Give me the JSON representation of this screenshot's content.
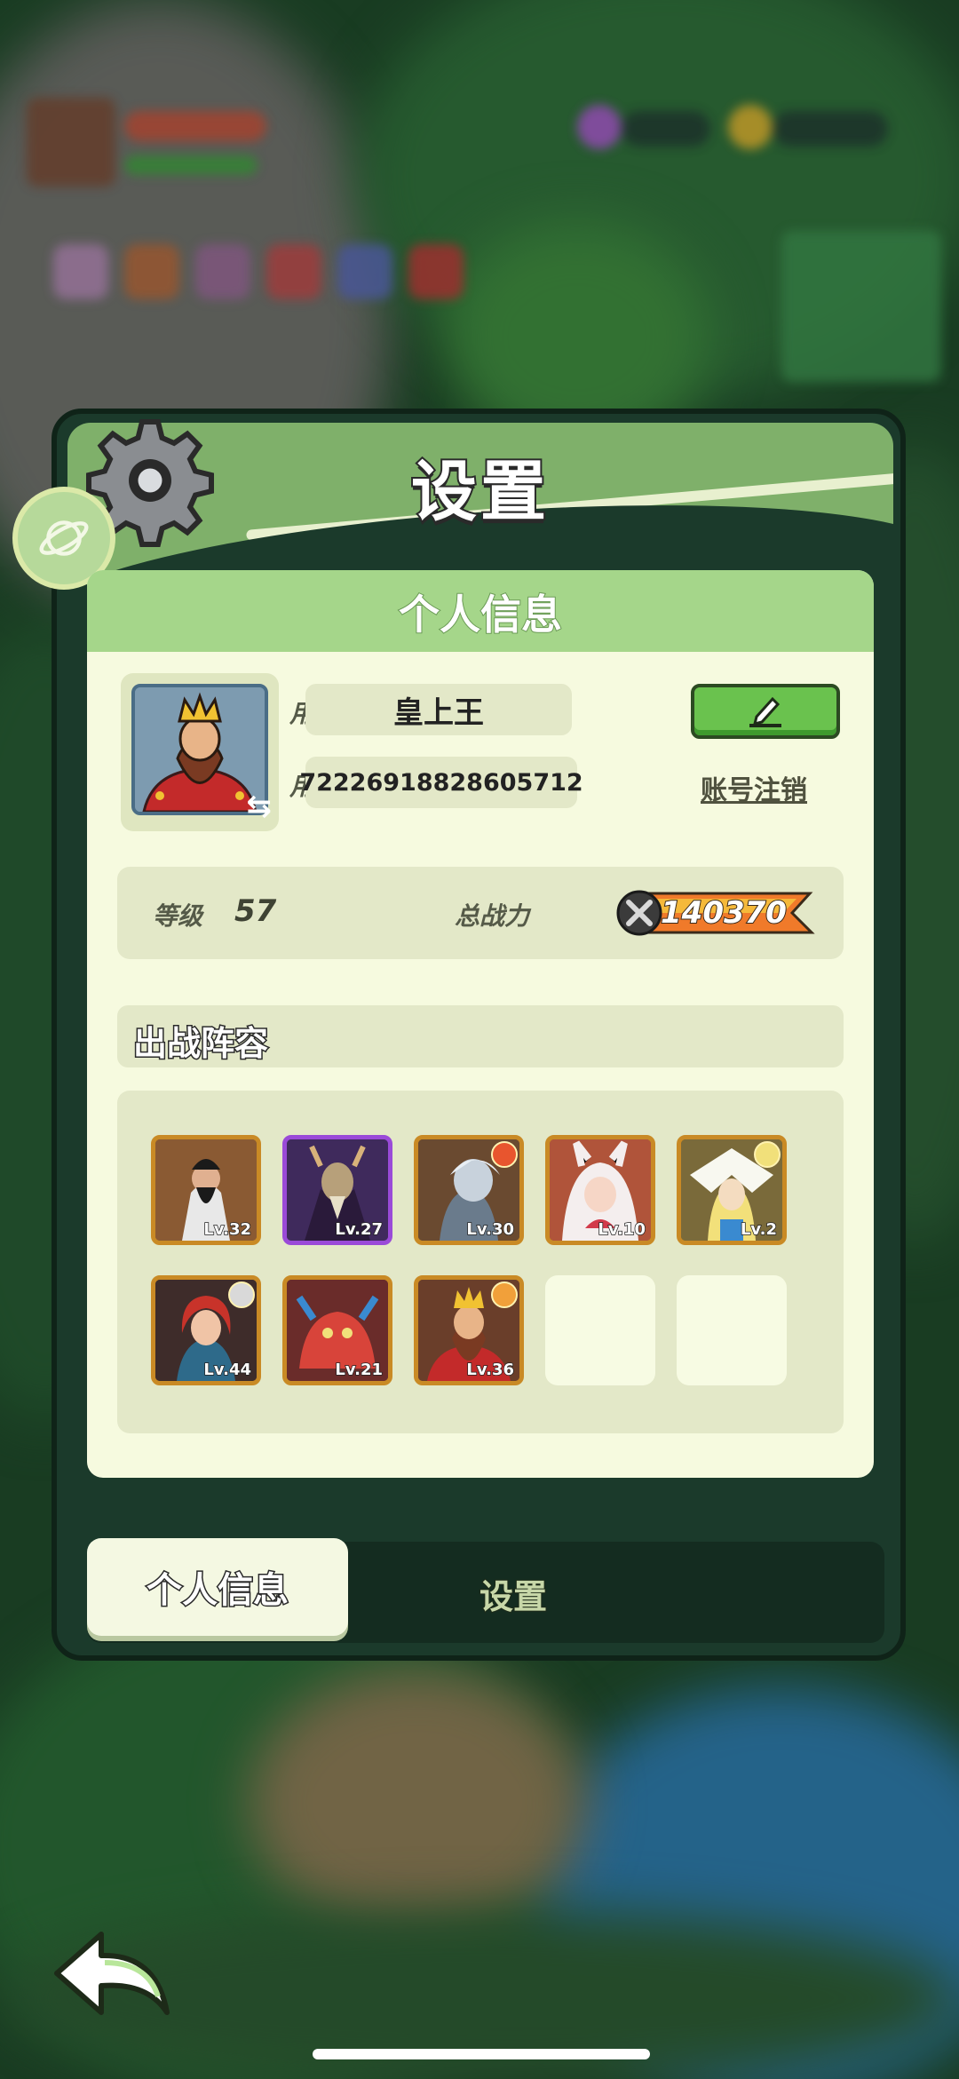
{
  "dialog": {
    "title": "设置"
  },
  "panel": {
    "title": "个人信息"
  },
  "profile": {
    "nickname_label": "用户昵称",
    "nickname_value": "皇上王",
    "id_label": "用户  ID",
    "id_value": "72226918828605712",
    "logout_label": "账号注销"
  },
  "stats": {
    "level_label": "等级",
    "level_value": "57",
    "power_label": "总战力",
    "power_value": "140370"
  },
  "lineup": {
    "title": "出战阵容",
    "heroes": [
      {
        "level": "Lv.32"
      },
      {
        "level": "Lv.27"
      },
      {
        "level": "Lv.30"
      },
      {
        "level": "Lv.10"
      },
      {
        "level": "Lv.2"
      },
      {
        "level": "Lv.44"
      },
      {
        "level": "Lv.21"
      },
      {
        "level": "Lv.36"
      }
    ]
  },
  "tabs": {
    "active_label": "个人信息",
    "inactive_label": "设置"
  },
  "icons": {
    "settings": "gear-icon",
    "planet": "planet-icon",
    "edit": "pencil-icon",
    "power": "crossed-swords-icon",
    "back": "back-arrow-icon",
    "swap": "swap-arrow-icon"
  },
  "colors": {
    "header_green": "#7fb06a",
    "panel_bg": "#f6fadf",
    "edit_button": "#6ac24e",
    "rare_border": "#c98a25",
    "epic_border": "#9a4ad8"
  }
}
